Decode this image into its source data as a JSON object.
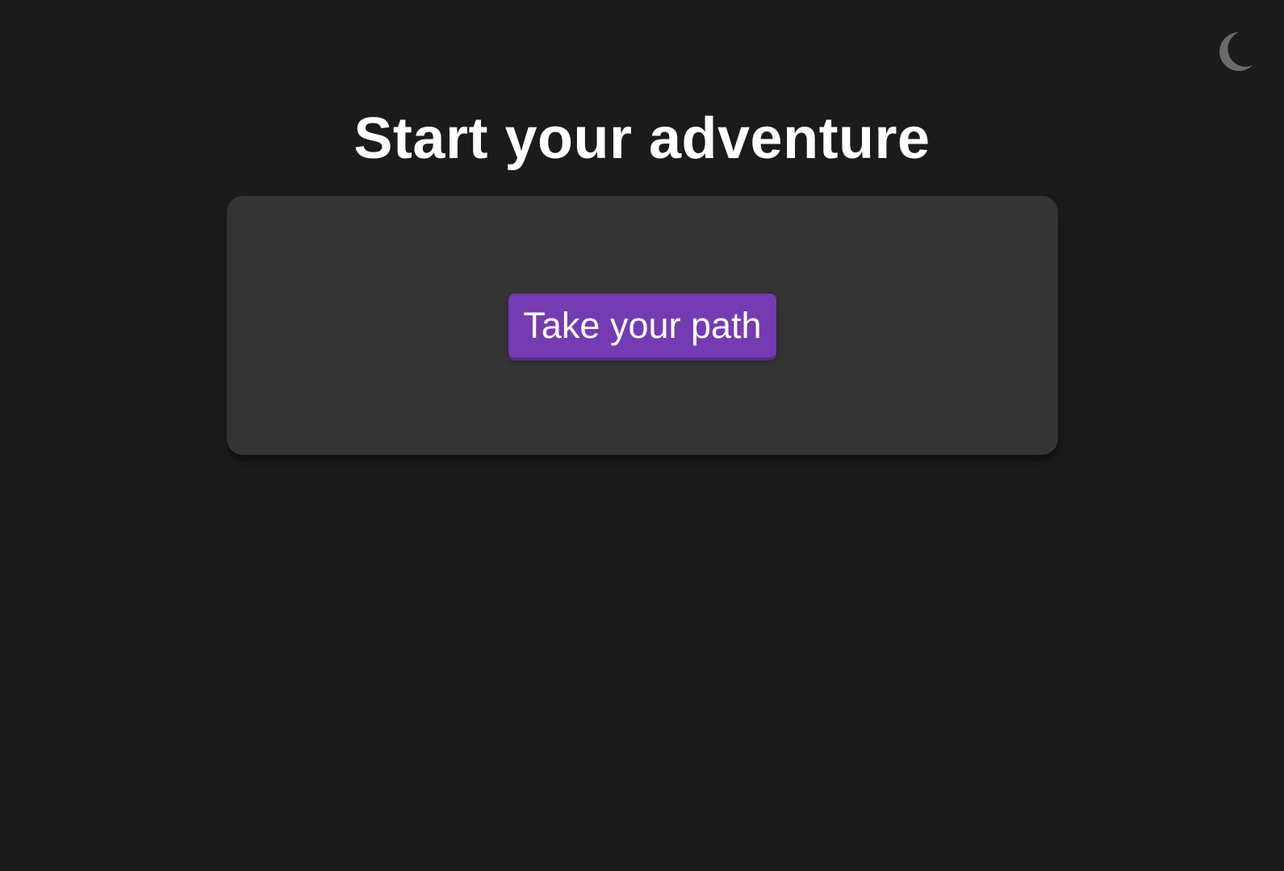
{
  "header": {
    "title": "Start your adventure",
    "theme_toggle_icon": "moon-icon"
  },
  "main": {
    "card": {
      "action_button_label": "Take your path"
    }
  },
  "colors": {
    "background": "#1b1b1b",
    "card": "#343434",
    "accent": "#743bb3",
    "text": "#ffffff",
    "icon": "#6b6b6b"
  }
}
